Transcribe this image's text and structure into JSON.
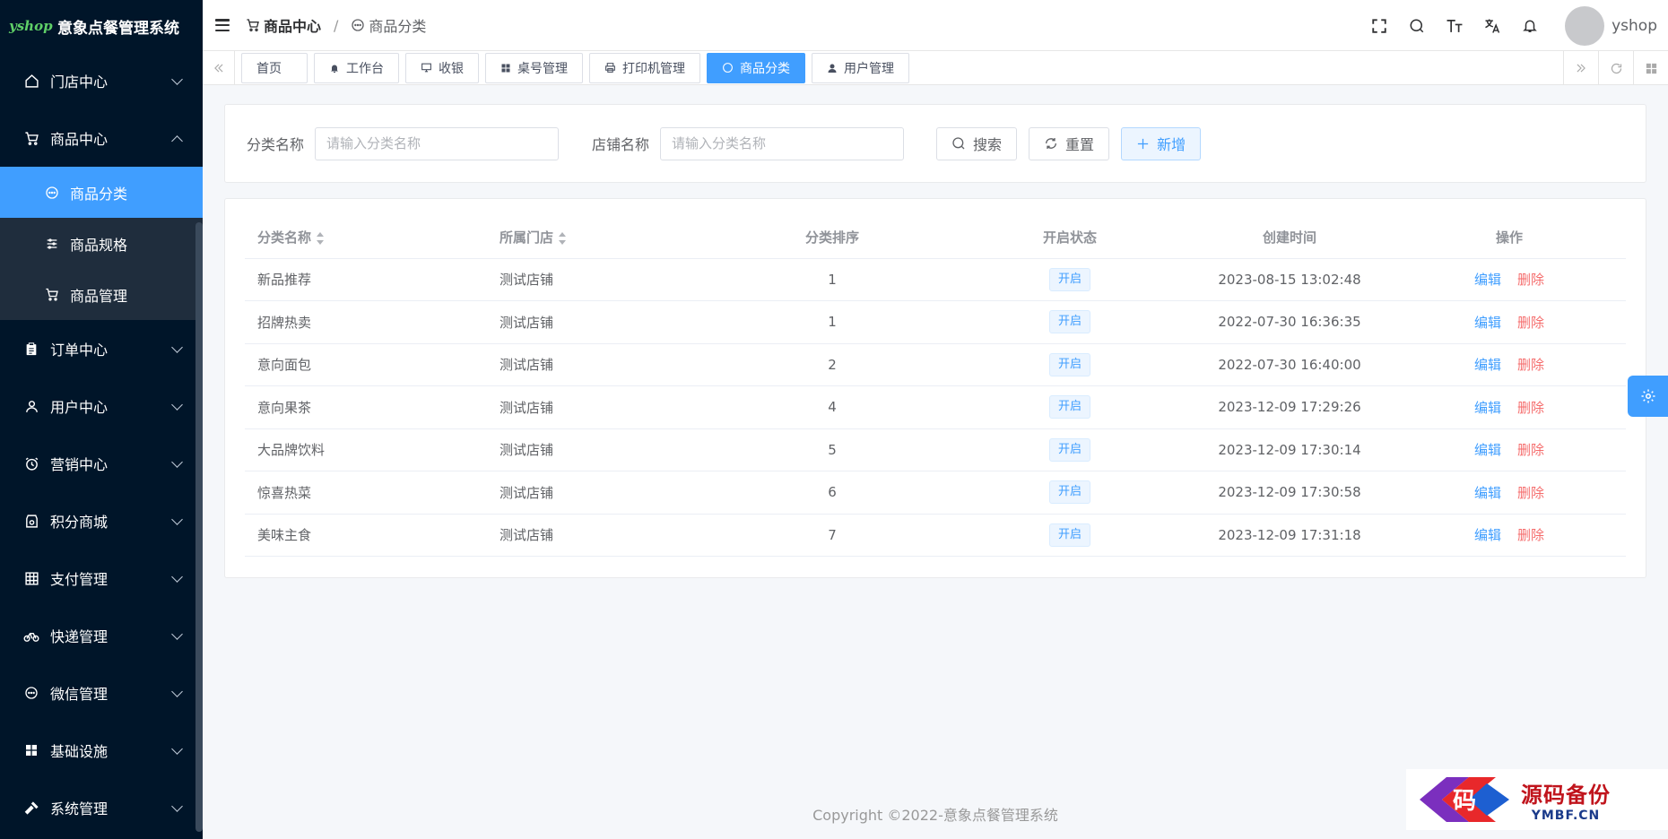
{
  "app": {
    "logo_text": "yshop",
    "title": "意象点餐管理系统"
  },
  "sidebar": {
    "menu_before": [
      {
        "label": "门店中心",
        "icon": "home-icon",
        "expanded": false
      }
    ],
    "goods_menu": {
      "label": "商品中心",
      "icon": "cart-icon",
      "expanded": true,
      "children": [
        {
          "label": "商品分类",
          "icon": "chat-icon",
          "active": true
        },
        {
          "label": "商品规格",
          "icon": "sliders-icon",
          "active": false
        },
        {
          "label": "商品管理",
          "icon": "cart-icon",
          "active": false
        }
      ]
    },
    "menu_after": [
      {
        "label": "订单中心",
        "icon": "clipboard-icon"
      },
      {
        "label": "用户中心",
        "icon": "user-icon"
      },
      {
        "label": "营销中心",
        "icon": "alarm-icon"
      },
      {
        "label": "积分商城",
        "icon": "wallet-icon"
      },
      {
        "label": "支付管理",
        "icon": "calculator-icon"
      },
      {
        "label": "快递管理",
        "icon": "bicycle-icon"
      },
      {
        "label": "微信管理",
        "icon": "chat-icon"
      },
      {
        "label": "基础设施",
        "icon": "grid-icon"
      },
      {
        "label": "系统管理",
        "icon": "hammer-icon"
      }
    ]
  },
  "navbar": {
    "breadcrumb": [
      "商品中心",
      "商品分类"
    ],
    "username": "yshop"
  },
  "tags": [
    {
      "label": "首页",
      "icon": ""
    },
    {
      "label": "工作台",
      "icon": "bell-icon"
    },
    {
      "label": "收银",
      "icon": "monitor-icon"
    },
    {
      "label": "桌号管理",
      "icon": "grid-icon"
    },
    {
      "label": "打印机管理",
      "icon": "printer-icon"
    },
    {
      "label": "商品分类",
      "icon": "chat-icon",
      "active": true
    },
    {
      "label": "用户管理",
      "icon": "user-icon"
    }
  ],
  "search": {
    "category_label": "分类名称",
    "category_placeholder": "请输入分类名称",
    "store_label": "店铺名称",
    "store_placeholder": "请输入分类名称",
    "search_btn": "搜索",
    "reset_btn": "重置",
    "add_btn": "新增"
  },
  "table": {
    "headers": [
      "分类名称",
      "所属门店",
      "分类排序",
      "开启状态",
      "创建时间",
      "操作"
    ],
    "edit_label": "编辑",
    "delete_label": "删除",
    "rows": [
      {
        "name": "新品推荐",
        "store": "测试店铺",
        "sort": "1",
        "status": "开启",
        "created": "2023-08-15 13:02:48"
      },
      {
        "name": "招牌热卖",
        "store": "测试店铺",
        "sort": "1",
        "status": "开启",
        "created": "2022-07-30 16:36:35"
      },
      {
        "name": "意向面包",
        "store": "测试店铺",
        "sort": "2",
        "status": "开启",
        "created": "2022-07-30 16:40:00"
      },
      {
        "name": "意向果茶",
        "store": "测试店铺",
        "sort": "4",
        "status": "开启",
        "created": "2023-12-09 17:29:26"
      },
      {
        "name": "大品牌饮料",
        "store": "测试店铺",
        "sort": "5",
        "status": "开启",
        "created": "2023-12-09 17:30:14"
      },
      {
        "name": "惊喜热菜",
        "store": "测试店铺",
        "sort": "6",
        "status": "开启",
        "created": "2023-12-09 17:30:58"
      },
      {
        "name": "美味主食",
        "store": "测试店铺",
        "sort": "7",
        "status": "开启",
        "created": "2023-12-09 17:31:18"
      }
    ]
  },
  "footer": "Copyright ©2022-意象点餐管理系统",
  "watermark": {
    "cn": "源码备份",
    "en": "YMBF.CN",
    "mark": "码"
  },
  "colors": {
    "sidebar_bg": "#001529",
    "accent": "#409eff",
    "danger": "#f56c6c"
  }
}
